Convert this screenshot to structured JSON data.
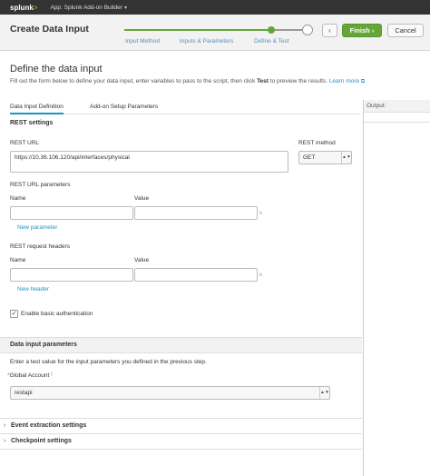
{
  "topbar": {
    "logo_text": "splunk",
    "logo_chevron": ">",
    "app_name": "App: Splunk Add-on Builder",
    "app_caret": "▾"
  },
  "header": {
    "title": "Create Data Input",
    "steps": [
      "Input Method",
      "Inputs & Parameters",
      "Define & Test"
    ],
    "back_label": "‹",
    "finish_label": "Finish ›",
    "cancel_label": "Cancel"
  },
  "main": {
    "section_title": "Define the data input",
    "help_before": "Fill out the form below to define your data input, enter variables to pass to the script, then click ",
    "help_bold": "Test",
    "help_after": " to preview the results. ",
    "help_link": "Learn more",
    "tabs": [
      "Data Input Definition",
      "Add-on Setup Parameters"
    ]
  },
  "output_panel": {
    "label": "Output:"
  },
  "rest": {
    "heading": "REST settings",
    "url_label": "REST URL",
    "url_value": "https://10.36.106.120/api/interfaces/physical",
    "method_label": "REST method",
    "method_value": "GET",
    "params_heading": "REST URL parameters",
    "name_label": "Name",
    "value_label": "Value",
    "new_parameter": "New parameter",
    "headers_heading": "REST request headers",
    "new_header": "New header",
    "remove_glyph": "×",
    "basic_auth_label": "Enable basic authentication",
    "check_glyph": "✓"
  },
  "data_input": {
    "heading": "Data input parameters",
    "instructions": "Enter a test value for the input parameters you defined in the previous step.",
    "required_mark": "*",
    "account_label": "Global Account",
    "account_info": "!",
    "account_value": "restapi"
  },
  "collapsibles": {
    "chevron": "›",
    "event_extraction": "Event extraction settings",
    "checkpoint": "Checkpoint settings"
  },
  "icons": {
    "external_link": "⧉",
    "select_arrow": "▲▼"
  },
  "colors": {
    "accent_green": "#65a637",
    "link_blue": "#1e93c6",
    "topbar": "#333333"
  }
}
